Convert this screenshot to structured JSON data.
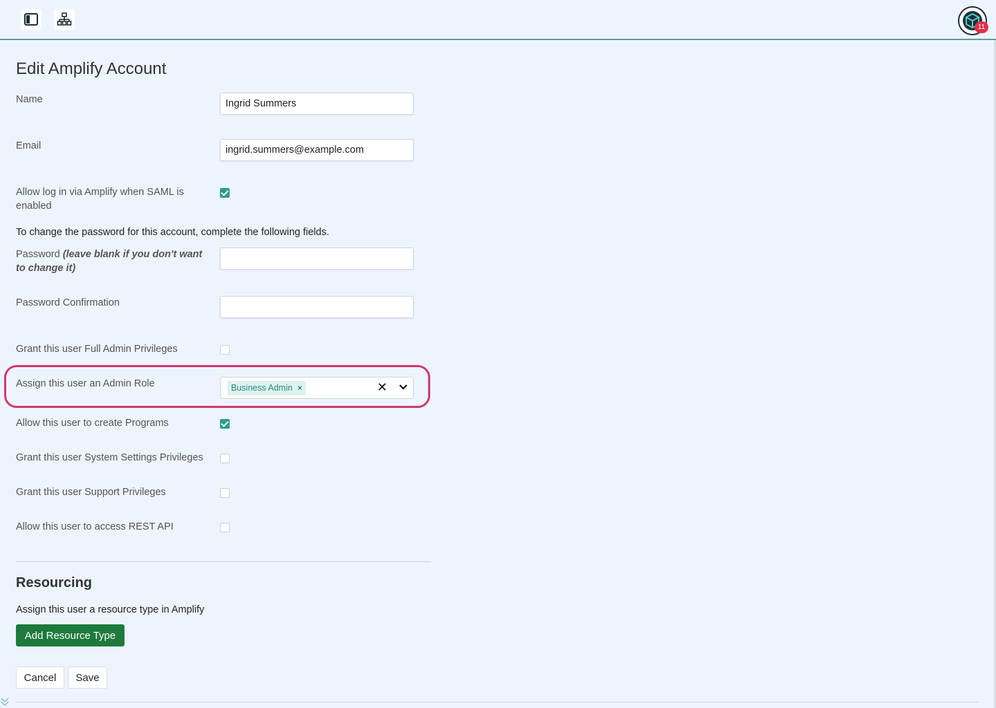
{
  "topbar": {
    "sidebar_toggle_icon": "sidebar-panel-icon",
    "hierarchy_icon": "org-chart-icon",
    "avatar_icon": "cube-logo-icon",
    "notification_count": "11"
  },
  "form": {
    "title": "Edit Amplify Account",
    "name_label": "Name",
    "name_value": "Ingrid Summers",
    "email_label": "Email",
    "email_value": "ingrid.summers@example.com",
    "saml_label": "Allow log in via Amplify when SAML is enabled",
    "saml_checked": true,
    "password_note": "To change the password for this account, complete the following fields.",
    "password_label": "Password",
    "password_hint": "(leave blank if you don't want to change it)",
    "password_value": "",
    "password_confirm_label": "Password Confirmation",
    "password_confirm_value": "",
    "full_admin_label": "Grant this user Full Admin Privileges",
    "full_admin_checked": false,
    "admin_role_label": "Assign this user an Admin Role",
    "admin_role_selected": "Business Admin",
    "create_programs_label": "Allow this user to create Programs",
    "create_programs_checked": true,
    "system_settings_label": "Grant this user System Settings Privileges",
    "system_settings_checked": false,
    "support_label": "Grant this user Support Privileges",
    "support_checked": false,
    "rest_api_label": "Allow this user to access REST API",
    "rest_api_checked": false
  },
  "resourcing": {
    "title": "Resourcing",
    "note": "Assign this user a resource type in Amplify",
    "add_button": "Add Resource Type"
  },
  "actions": {
    "cancel": "Cancel",
    "save": "Save"
  },
  "colors": {
    "accent": "#2a9d8f",
    "primary_button": "#1e7a3c",
    "highlight": "#d0386a",
    "badge": "#e0304a"
  }
}
